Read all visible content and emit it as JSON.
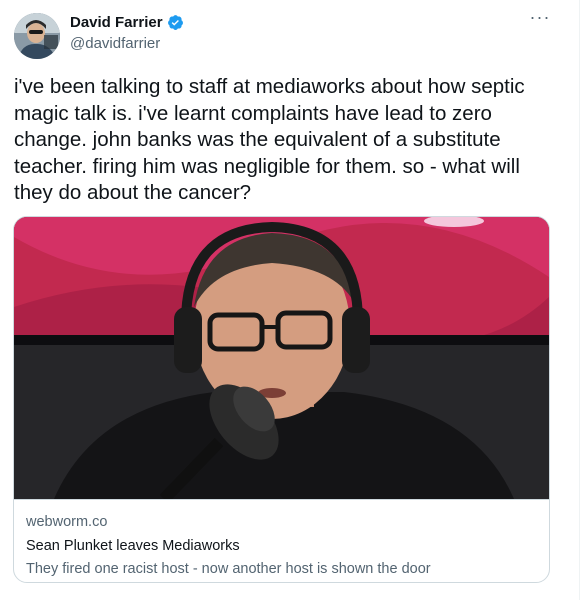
{
  "author": {
    "name": "David Farrier",
    "handle": "@davidfarrier",
    "verified": true
  },
  "tweet": {
    "text": "i've been talking to staff at mediaworks about how septic magic talk is. i've learnt complaints have lead to zero change. john banks was the equivalent of a substitute teacher. firing him was negligible for them. so - what will they do about the cancer?"
  },
  "card": {
    "domain": "webworm.co",
    "title": "Sean Plunket leaves Mediaworks",
    "description": "They fired one racist host - now another host is shown the door"
  },
  "icons": {
    "more": "more-horizontal-icon",
    "verified": "verified-badge-icon"
  },
  "colors": {
    "verified_blue": "#1d9bf0",
    "text": "#0f1419",
    "secondary_text": "#536471",
    "border": "#cfd9de"
  }
}
